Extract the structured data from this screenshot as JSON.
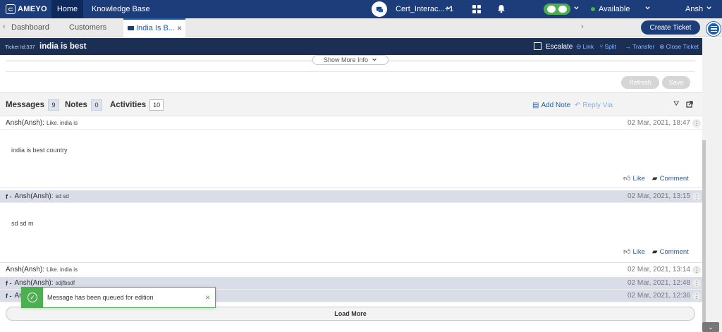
{
  "topbar": {
    "logo": "AMEYO",
    "home": "Home",
    "knowledge_base": "Knowledge Base",
    "campaign": "Cert_Interac...+1",
    "status": "Available",
    "user": "Ansh"
  },
  "tabs": {
    "dashboard": "Dashboard",
    "customers": "Customers",
    "active": "India Is B...",
    "create_ticket": "Create Ticket"
  },
  "ticket": {
    "id_label": "Ticket Id:337",
    "title": "india is best",
    "escalate": "Escalate",
    "link": "Link",
    "split": "Split",
    "transfer": "Transfer",
    "close": "Close Ticket"
  },
  "panel": {
    "show_more": "Show More Info",
    "refresh": "Refresh",
    "save": "Save"
  },
  "message_tabs": {
    "messages": "Messages",
    "messages_count": "9",
    "notes": "Notes",
    "notes_count": "0",
    "activities": "Activities",
    "activities_count": "10",
    "add_note": "Add Note",
    "reply_via": "Reply Via"
  },
  "messages": [
    {
      "sender": "Ansh(Ansh):",
      "snippet": "Like. india is",
      "date": "02 Mar, 2021, 18:47",
      "body": "india is best country",
      "like": "Like",
      "comment": "Comment"
    },
    {
      "prefix": "f -",
      "sender": "Ansh(Ansh):",
      "snippet": "sd sd",
      "date": "02 Mar, 2021, 13:15",
      "body": "sd sd m",
      "like": "Like",
      "comment": "Comment"
    },
    {
      "sender": "Ansh(Ansh):",
      "snippet": "Like. india is",
      "date": "02 Mar, 2021, 13:14"
    },
    {
      "prefix": "f -",
      "sender": "Ansh(Ansh):",
      "snippet": "sdjfbsdf",
      "date": "02 Mar, 2021, 12:48"
    },
    {
      "prefix": "f -",
      "sender": "An",
      "date": "02 Mar, 2021, 12:36"
    }
  ],
  "load_more": "Load More",
  "toast": {
    "message": "Message has been queued for edition"
  },
  "colors": {
    "navy": "#1d3c7a",
    "ticket_bar": "#1b2f55",
    "link_blue": "#1d5fb0",
    "success": "#4caf50"
  }
}
